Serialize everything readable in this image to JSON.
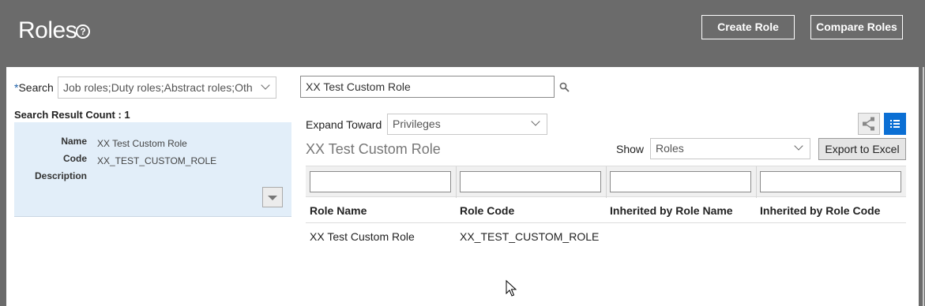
{
  "header": {
    "title": "Roles",
    "help_glyph": "?",
    "create_role_label": "Create Role",
    "compare_roles_label": "Compare Roles"
  },
  "search": {
    "required_marker": "*",
    "label": "Search",
    "role_types_value": "Job roles;Duty roles;Abstract roles;Oth",
    "keyword_value": "XX Test Custom Role"
  },
  "results": {
    "count_label": "Search Result Count : 1",
    "card": {
      "name_label": "Name",
      "name_value": "XX Test Custom Role",
      "code_label": "Code",
      "code_value": "XX_TEST_CUSTOM_ROLE",
      "description_label": "Description",
      "description_value": ""
    }
  },
  "detail": {
    "expand_toward_label": "Expand Toward",
    "expand_toward_value": "Privileges",
    "role_heading": "XX Test Custom Role",
    "show_label": "Show",
    "show_value": "Roles",
    "export_label": "Export to Excel",
    "columns": [
      "Role Name",
      "Role Code",
      "Inherited by Role Name",
      "Inherited by Role Code"
    ],
    "rows": [
      [
        "XX Test Custom Role",
        "XX_TEST_CUSTOM_ROLE",
        "",
        ""
      ]
    ]
  },
  "colors": {
    "header_bg": "#6b6b6b",
    "card_bg": "#e2eef9",
    "accent_blue": "#0b6fd4"
  },
  "icons": [
    "help-icon",
    "search-icon",
    "graph-view-icon",
    "list-view-icon",
    "chevron-down-icon",
    "mouse-cursor-icon"
  ]
}
